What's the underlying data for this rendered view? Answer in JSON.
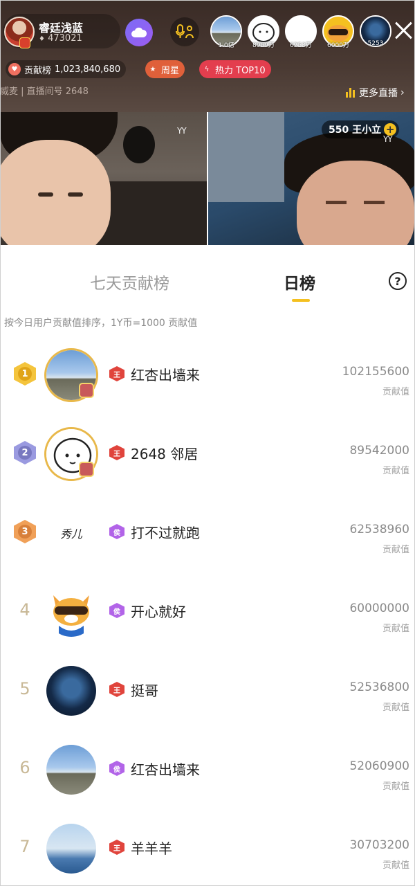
{
  "host": {
    "name": "睿廷浅蓝",
    "fans": "473021"
  },
  "viewers": [
    {
      "count": "1.0亿"
    },
    {
      "count": "8959万"
    },
    {
      "count": "6253万"
    },
    {
      "count": "6000万"
    },
    {
      "count": "5253"
    }
  ],
  "pills": {
    "rank_label": "贡献榜",
    "rank_value": "1,023,840,680",
    "weekly_star": "周星",
    "heat_top": "热力 TOP10"
  },
  "sub_info": "威麦 | 直播间号 2648",
  "more_live": "更多直播",
  "guest": {
    "tag": "550 王小立",
    "plus": "+"
  },
  "watermark": "YY",
  "tabs": {
    "week": "七天贡献榜",
    "day": "日榜",
    "help": "?"
  },
  "description": "按今日用户贡献值排序，1Y币=1000 贡献值",
  "score_unit": "贡献值",
  "level_red": "王",
  "level_purple": "侯",
  "ranking": [
    {
      "rank": "1",
      "name": "红杏出墙来",
      "score": "102155600"
    },
    {
      "rank": "2",
      "name": "2648 邻居",
      "score": "89542000"
    },
    {
      "rank": "3",
      "name": "打不过就跑",
      "score": "62538960"
    },
    {
      "rank": "4",
      "name": "开心就好",
      "score": "60000000"
    },
    {
      "rank": "5",
      "name": "挺哥",
      "score": "52536800"
    },
    {
      "rank": "6",
      "name": "红杏出墙来",
      "score": "52060900"
    },
    {
      "rank": "7",
      "name": "羊羊羊",
      "score": "30703200"
    }
  ],
  "avatar_text": "秀儿",
  "colors": {
    "accent": "#f4c020",
    "gold": "#e8b84a",
    "silver": "#8f8fd8",
    "bronze": "#ee9a50",
    "level_red": "#e0443c",
    "level_purple": "#b264e8"
  }
}
